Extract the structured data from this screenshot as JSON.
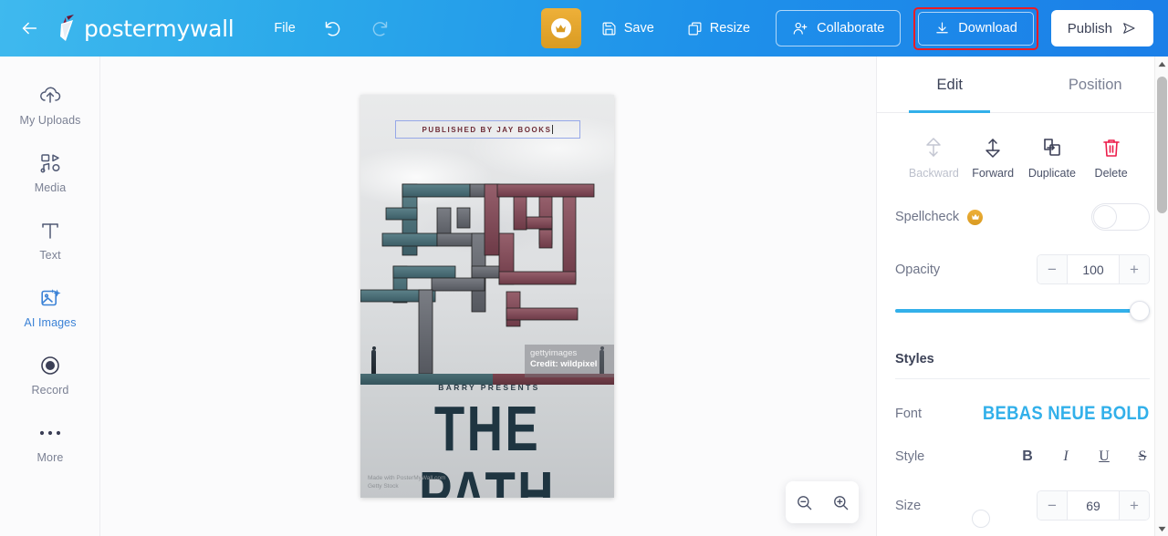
{
  "topbar": {
    "back_icon": "arrow-left-icon",
    "logo_text": "postermywall",
    "file_label": "File",
    "undo_icon": "undo-icon",
    "redo_icon": "redo-icon",
    "premium_icon": "crown-icon",
    "save_label": "Save",
    "save_icon": "save-disk-icon",
    "resize_label": "Resize",
    "resize_icon": "resize-icon",
    "collaborate_label": "Collaborate",
    "collaborate_icon": "person-add-icon",
    "download_label": "Download",
    "download_icon": "download-icon",
    "publish_label": "Publish",
    "publish_icon": "send-icon",
    "highlight_color": "#ec1c24",
    "bg_color_left": "#3fb9ee",
    "bg_color_right": "#1b7fe8"
  },
  "sidebar": {
    "items": [
      {
        "label": "My Uploads",
        "icon": "cloud-upload-icon",
        "active": false
      },
      {
        "label": "Media",
        "icon": "media-icon",
        "active": false
      },
      {
        "label": "Text",
        "icon": "text-t-icon",
        "active": false
      },
      {
        "label": "AI Images",
        "icon": "ai-image-icon",
        "active": true
      },
      {
        "label": "Record",
        "icon": "record-circle-icon",
        "active": false
      },
      {
        "label": "More",
        "icon": "ellipsis-icon",
        "active": false
      }
    ],
    "active_color": "#3b82d6"
  },
  "canvas": {
    "poster": {
      "selected_text": "PUBLISHED BY JAY BOOKS",
      "presents_line": "BARRY PRESENTS",
      "title": "THE PATH",
      "watermark_brand": "getty",
      "watermark_brand_light": "images",
      "watermark_credit": "Credit: wildpixel",
      "footer_line1": "Made with PosterMyWall.com",
      "footer_line2": "Getty Stock"
    },
    "zoom_out_icon": "zoom-out-icon",
    "zoom_in_icon": "zoom-in-icon"
  },
  "rightpanel": {
    "tabs": [
      {
        "label": "Edit",
        "active": true
      },
      {
        "label": "Position",
        "active": false
      }
    ],
    "actions": [
      {
        "label": "Backward",
        "icon": "arrow-down-backward-icon",
        "disabled": true
      },
      {
        "label": "Forward",
        "icon": "arrow-up-forward-icon",
        "disabled": false
      },
      {
        "label": "Duplicate",
        "icon": "duplicate-icon",
        "disabled": false
      },
      {
        "label": "Delete",
        "icon": "trash-icon",
        "disabled": false
      }
    ],
    "delete_color": "#ec1c4a",
    "spellcheck": {
      "label": "Spellcheck",
      "badge_icon": "crown-icon",
      "enabled": false
    },
    "opacity": {
      "label": "Opacity",
      "value": "100",
      "minus": "−",
      "plus": "+",
      "slider_percent": 100,
      "slider_color": "#32b0ea"
    },
    "styles": {
      "section_label": "Styles",
      "font_label": "Font",
      "font_value": "BEBAS NEUE BOLD",
      "font_color": "#32b0ea",
      "style_label": "Style",
      "style_buttons": [
        "B",
        "I",
        "U",
        "S"
      ],
      "size_label": "Size",
      "size_value": "69",
      "minus": "−",
      "plus": "+"
    }
  }
}
